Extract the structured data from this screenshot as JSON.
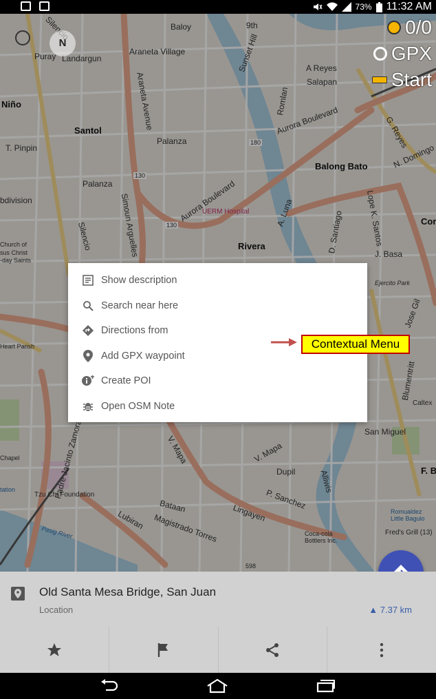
{
  "status_bar": {
    "battery_percent": "73%",
    "time": "11:32 AM",
    "left_icons": [
      "image-icon",
      "sms-disabled-icon"
    ],
    "right_icons": [
      "mute-icon",
      "wifi-icon",
      "signal-icon",
      "battery-icon"
    ]
  },
  "map": {
    "compass_label": "N",
    "hud": {
      "gps_label": "0/0",
      "gpx_label": "GPX",
      "start_label": "Start"
    },
    "labels": [
      {
        "text": "Baloy"
      },
      {
        "text": "Araneta Village"
      },
      {
        "text": "Landargun"
      },
      {
        "text": "Puray"
      },
      {
        "text": "Silencio"
      },
      {
        "text": "Niño"
      },
      {
        "text": "Santol"
      },
      {
        "text": "T. Pinpin"
      },
      {
        "text": "Palanza"
      },
      {
        "text": "Palanza"
      },
      {
        "text": "Araneta Avenue"
      },
      {
        "text": "Sunset Hill"
      },
      {
        "text": "9th"
      },
      {
        "text": "A Reyes"
      },
      {
        "text": "Salapan"
      },
      {
        "text": "Aurora Boulevard"
      },
      {
        "text": "Aurora Boulevard"
      },
      {
        "text": "Balong Bato"
      },
      {
        "text": "UERM Hospital"
      },
      {
        "text": "Rivera"
      },
      {
        "text": "J. Basa"
      },
      {
        "text": "bdivision"
      },
      {
        "text": "Church of"
      },
      {
        "text": "sus Christ"
      },
      {
        "text": "-day Saints"
      },
      {
        "text": "Heart Parish"
      },
      {
        "text": "Chapel"
      },
      {
        "text": "tation"
      },
      {
        "text": "Tzu Chi Foundation"
      },
      {
        "text": "Lubiran"
      },
      {
        "text": "Magistrado Torres"
      },
      {
        "text": "Bataan"
      },
      {
        "text": "Lingayen"
      },
      {
        "text": "P. Sanchez"
      },
      {
        "text": "V. Mapa"
      },
      {
        "text": "V. Mapa"
      },
      {
        "text": "Dupil"
      },
      {
        "text": "Alliwis"
      },
      {
        "text": "San Miguel"
      },
      {
        "text": "Ejercito Park"
      },
      {
        "text": "Jose Gil"
      },
      {
        "text": "Blumentritt"
      },
      {
        "text": "Caltex"
      },
      {
        "text": "Romualdez Little Baguio"
      },
      {
        "text": "Fred's Grill (13)"
      },
      {
        "text": "Coca-cola Bottlers Inc."
      },
      {
        "text": "Pasig River"
      },
      {
        "text": "Padre Jacinto Zamora"
      },
      {
        "text": "N. Domingo"
      },
      {
        "text": "G. Reyes"
      },
      {
        "text": "Cor"
      },
      {
        "text": "F. Bl"
      },
      {
        "text": "130"
      },
      {
        "text": "130"
      },
      {
        "text": "180"
      },
      {
        "text": "598"
      },
      {
        "text": "Simoun Arguelles"
      },
      {
        "text": "Silencio"
      },
      {
        "text": "Lope K. Santos"
      },
      {
        "text": "D. Santiago"
      },
      {
        "text": "A. Luna"
      },
      {
        "text": "Romlan"
      }
    ]
  },
  "context_menu": {
    "items": [
      {
        "label": "Show description",
        "icon": "description-icon"
      },
      {
        "label": "Search near here",
        "icon": "search-icon"
      },
      {
        "label": "Directions from",
        "icon": "directions-icon"
      },
      {
        "label": "Add GPX waypoint",
        "icon": "location-pin-icon"
      },
      {
        "label": "Create POI",
        "icon": "add-poi-icon"
      },
      {
        "label": "Open OSM Note",
        "icon": "bug-icon"
      }
    ]
  },
  "annotation": {
    "label": "Contextual Menu",
    "color_fill": "#ffff00",
    "color_border": "#c00000"
  },
  "info_panel": {
    "title": "Old Santa Mesa Bridge, San Juan",
    "subtitle": "Location",
    "distance": "7.37 km",
    "pin_icon": "location-pin-icon"
  },
  "action_bar": {
    "buttons": [
      {
        "name": "favorite",
        "icon": "star-icon"
      },
      {
        "name": "marker",
        "icon": "flag-icon"
      },
      {
        "name": "share",
        "icon": "share-icon"
      },
      {
        "name": "more",
        "icon": "more-vert-icon"
      }
    ]
  },
  "nav_bar": {
    "buttons": [
      "back-icon",
      "home-icon",
      "recent-apps-icon"
    ]
  },
  "colors": {
    "fab": "#3f51b5",
    "map_background": "#e8e4dc",
    "road_major": "#e8a88e",
    "road_secondary": "#f2d58a",
    "water": "#a9cbe0",
    "panel": "#d1d1d1"
  }
}
